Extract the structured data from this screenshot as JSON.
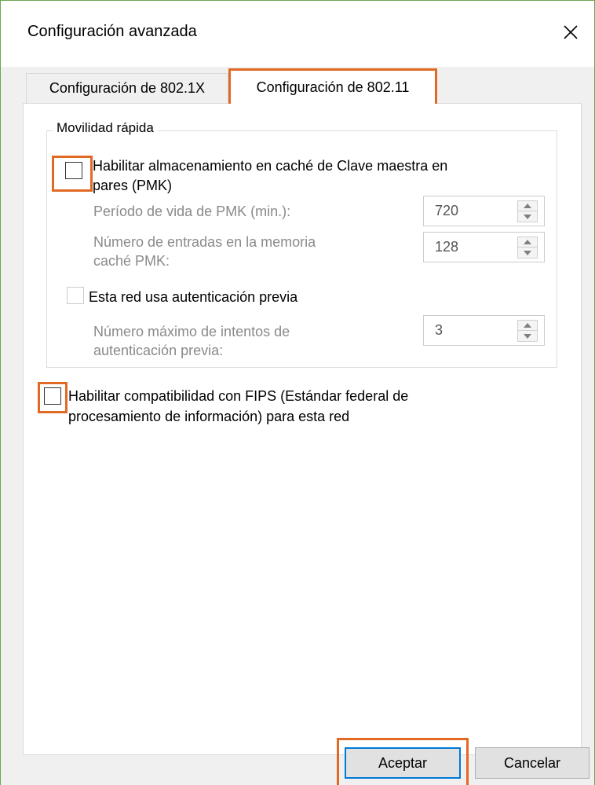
{
  "window": {
    "title": "Configuración avanzada",
    "close_icon": "close-icon"
  },
  "tabs": [
    {
      "label": "Configuración de 802.1X",
      "selected": false
    },
    {
      "label": "Configuración de 802.11",
      "selected": true
    }
  ],
  "fast_roaming": {
    "group_label": "Movilidad rápida",
    "pmk_cache": {
      "label_line1": "Habilitar almacenamiento en caché de Clave maestra en",
      "label_line2": "pares (PMK)",
      "checked": false
    },
    "pmk_lifetime": {
      "label": "Período de vida de PMK (min.):",
      "value": "720"
    },
    "pmk_entries": {
      "label_line1": "Número de entradas en la memoria",
      "label_line2": "caché PMK:",
      "value": "128"
    },
    "preauth": {
      "label": "Esta red usa autenticación previa",
      "checked": false
    },
    "preauth_attempts": {
      "label_line1": "Número máximo de intentos de",
      "label_line2": "autenticación previa:",
      "value": "3"
    }
  },
  "fips": {
    "label_line1": "Habilitar compatibilidad con FIPS (Estándar federal de",
    "label_line2": "procesamiento de información) para esta red",
    "checked": false
  },
  "buttons": {
    "ok": "Aceptar",
    "cancel": "Cancelar"
  },
  "colors": {
    "highlight": "#e06a24",
    "focus_border": "#0078d7",
    "disabled_text": "#8a8a8a"
  }
}
